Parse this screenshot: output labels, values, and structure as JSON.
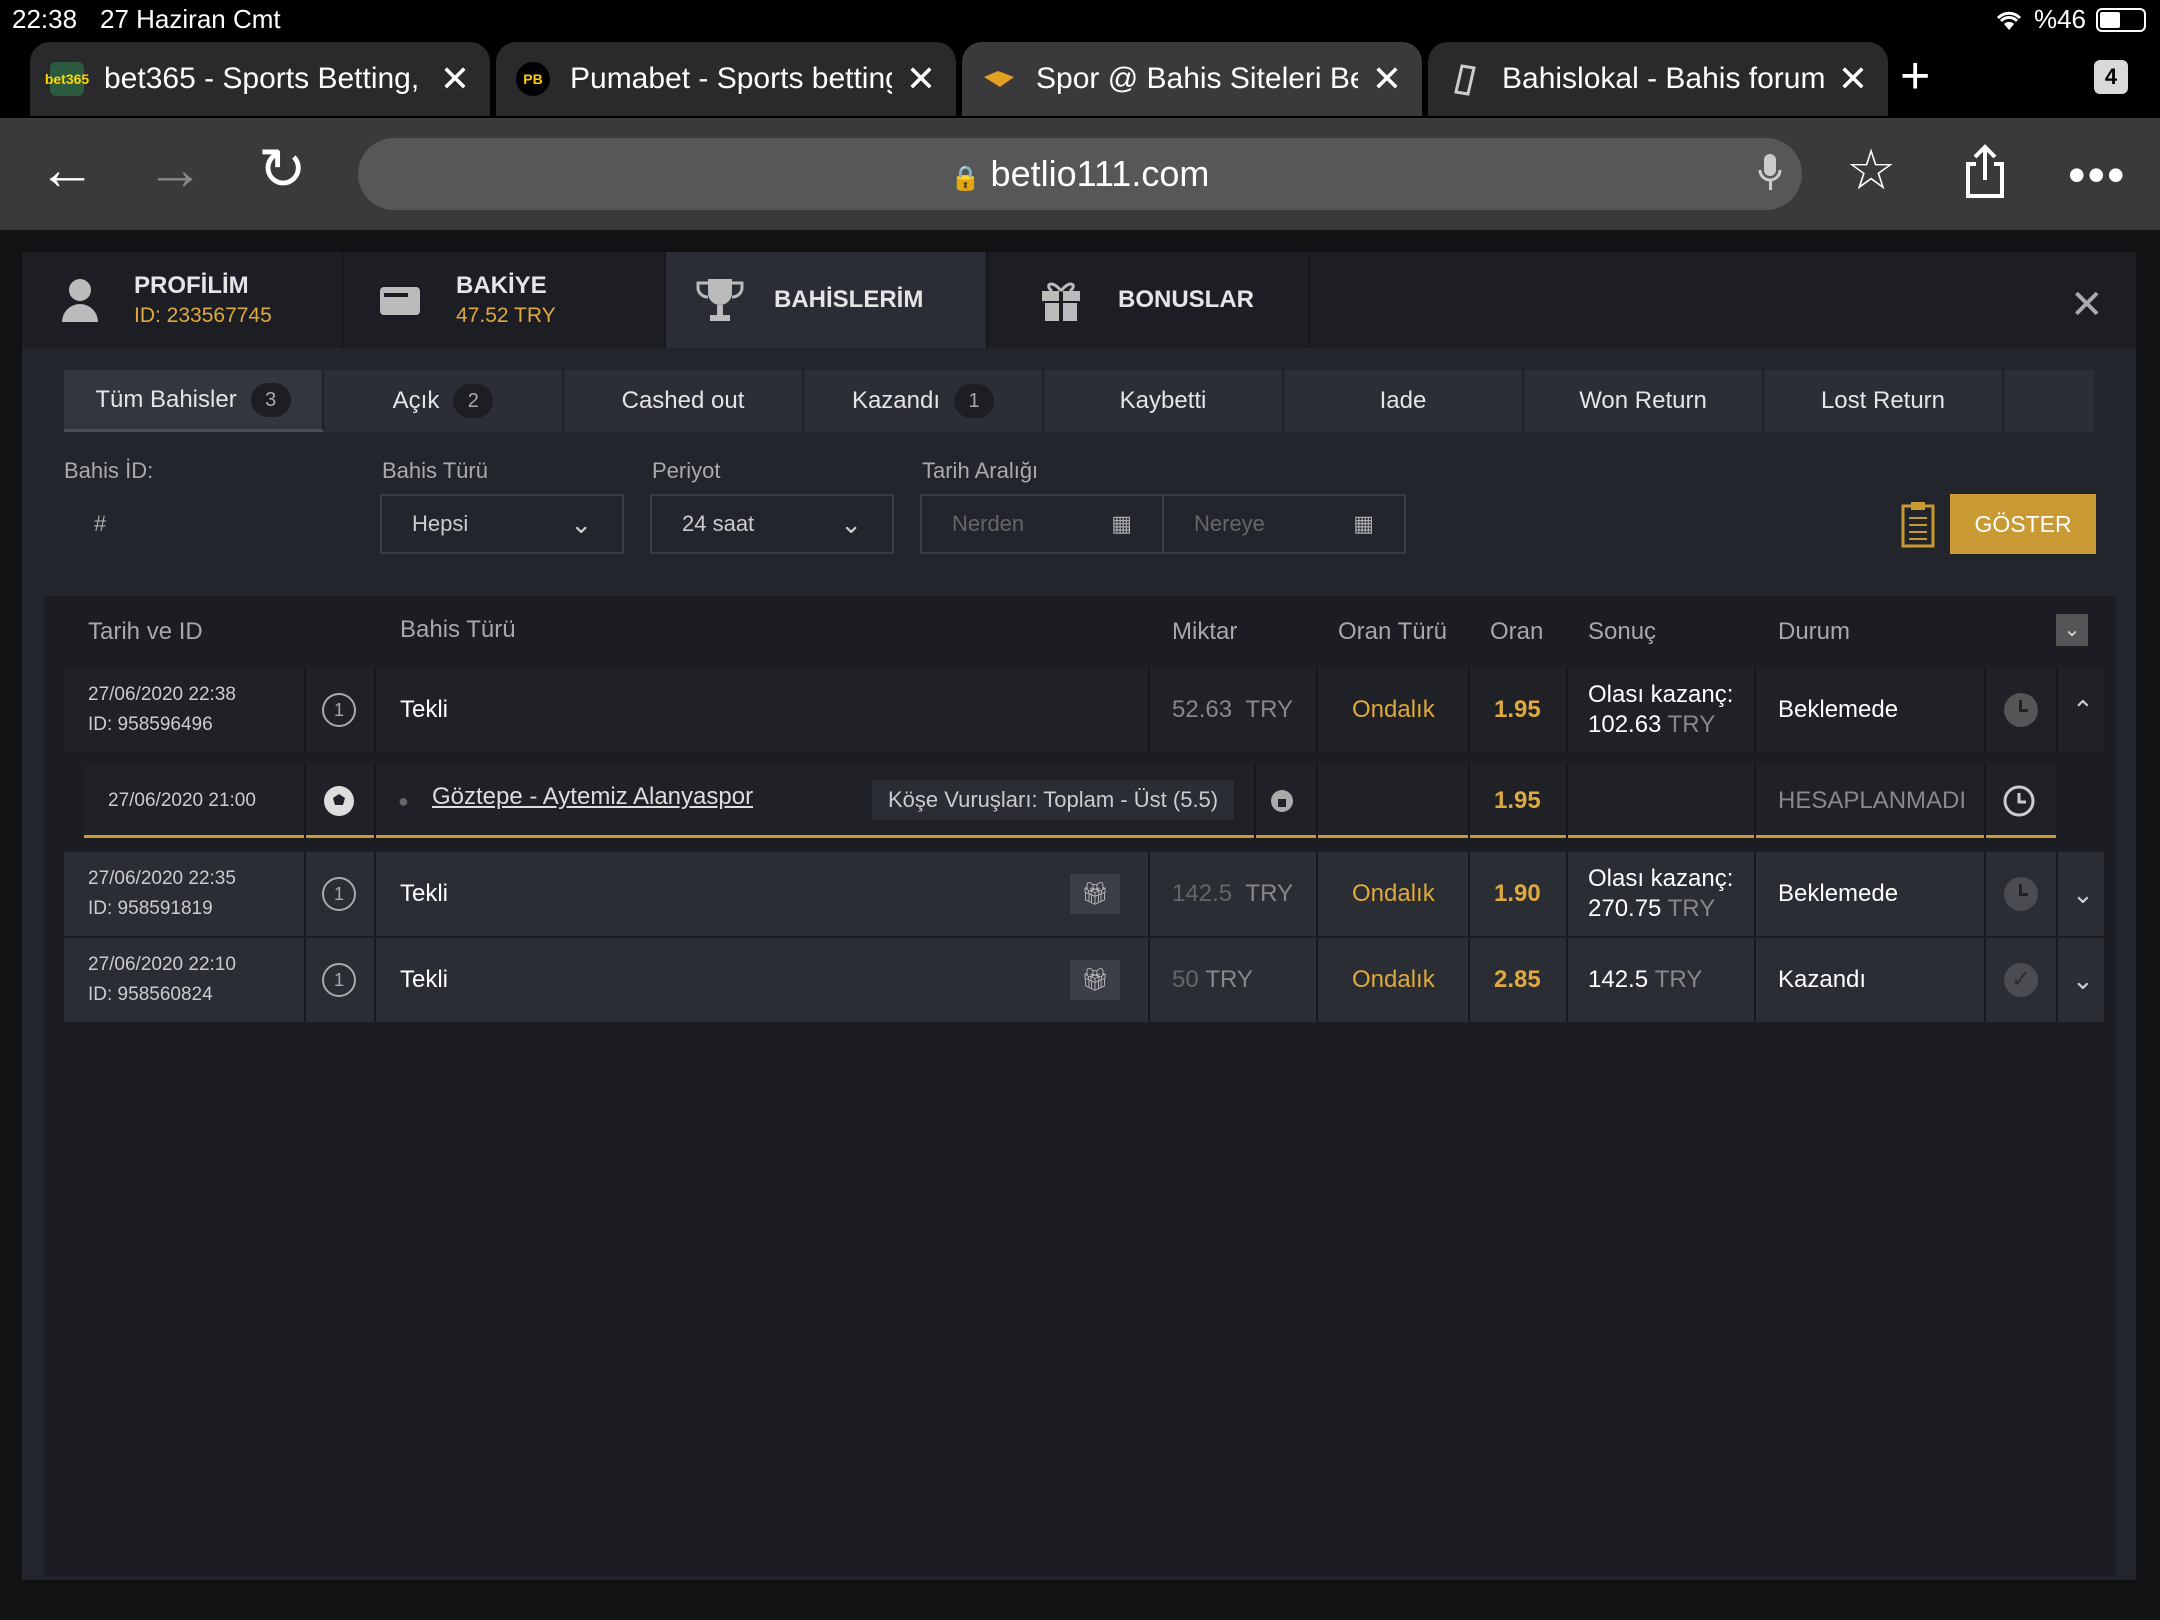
{
  "status": {
    "time": "22:38",
    "date": "27 Haziran Cmt",
    "battery": "%46"
  },
  "tabs": [
    {
      "title": "bet365 - Sports Betting,",
      "fav": "bet365"
    },
    {
      "title": "Pumabet - Sports betting",
      "fav": "PB"
    },
    {
      "title": "Spor @ Bahis Siteleri Bet",
      "fav": ""
    },
    {
      "title": "Bahislokal - Bahis forum",
      "fav": ""
    }
  ],
  "tab_count": "4",
  "url": "betlio111.com",
  "modal": {
    "profile_label": "PROFİLİM",
    "profile_id": "ID: 233567745",
    "balance_label": "BAKİYE",
    "balance_value": "47.52 TRY",
    "bets_label": "BAHİSLERİM",
    "bonus_label": "BONUSLAR"
  },
  "subtabs": [
    {
      "label": "Tüm Bahisler",
      "badge": "3"
    },
    {
      "label": "Açık",
      "badge": "2"
    },
    {
      "label": "Cashed out",
      "badge": ""
    },
    {
      "label": "Kazandı",
      "badge": "1"
    },
    {
      "label": "Kaybetti",
      "badge": ""
    },
    {
      "label": "Iade",
      "badge": ""
    },
    {
      "label": "Won Return",
      "badge": ""
    },
    {
      "label": "Lost Return",
      "badge": ""
    }
  ],
  "filters": {
    "bet_id_label": "Bahis İD:",
    "bet_id_placeholder": "#",
    "bet_type_label": "Bahis Türü",
    "bet_type_value": "Hepsi",
    "period_label": "Periyot",
    "period_value": "24 saat",
    "date_range_label": "Tarih Aralığı",
    "from_placeholder": "Nerden",
    "to_placeholder": "Nereye",
    "show_button": "GÖSTER"
  },
  "columns": {
    "date_id": "Tarih ve ID",
    "bet_type": "Bahis Türü",
    "amount": "Miktar",
    "odds_type": "Oran Türü",
    "odds": "Oran",
    "result": "Sonuç",
    "status": "Durum"
  },
  "bets": [
    {
      "date": "27/06/2020 22:38",
      "id": "ID: 958596496",
      "type": "Tekli",
      "amount": "52.63",
      "currency": "TRY",
      "odds_type": "Ondalık",
      "odds": "1.95",
      "result_label": "Olası kazanç:",
      "result_value": "102.63",
      "result_currency": "TRY",
      "status": "Beklemede"
    },
    {
      "date": "27/06/2020 22:35",
      "id": "ID: 958591819",
      "type": "Tekli",
      "amount": "142.5",
      "currency": "TRY",
      "odds_type": "Ondalık",
      "odds": "1.90",
      "result_label": "Olası kazanç:",
      "result_value": "270.75",
      "result_currency": "TRY",
      "status": "Beklemede"
    },
    {
      "date": "27/06/2020 22:10",
      "id": "ID: 958560824",
      "type": "Tekli",
      "amount": "50",
      "currency": "TRY",
      "odds_type": "Ondalık",
      "odds": "2.85",
      "result_label": "",
      "result_value": "142.5",
      "result_currency": "TRY",
      "status": "Kazandı"
    }
  ],
  "selection": {
    "date": "27/06/2020 21:00",
    "match": "Göztepe - Aytemiz Alanyaspor",
    "market": "Köşe Vuruşları: Toplam - Üst (5.5)",
    "odds": "1.95",
    "status": "HESAPLANMADI"
  },
  "colors": {
    "accent": "#c99a33",
    "gold_text": "#e0a93e"
  }
}
